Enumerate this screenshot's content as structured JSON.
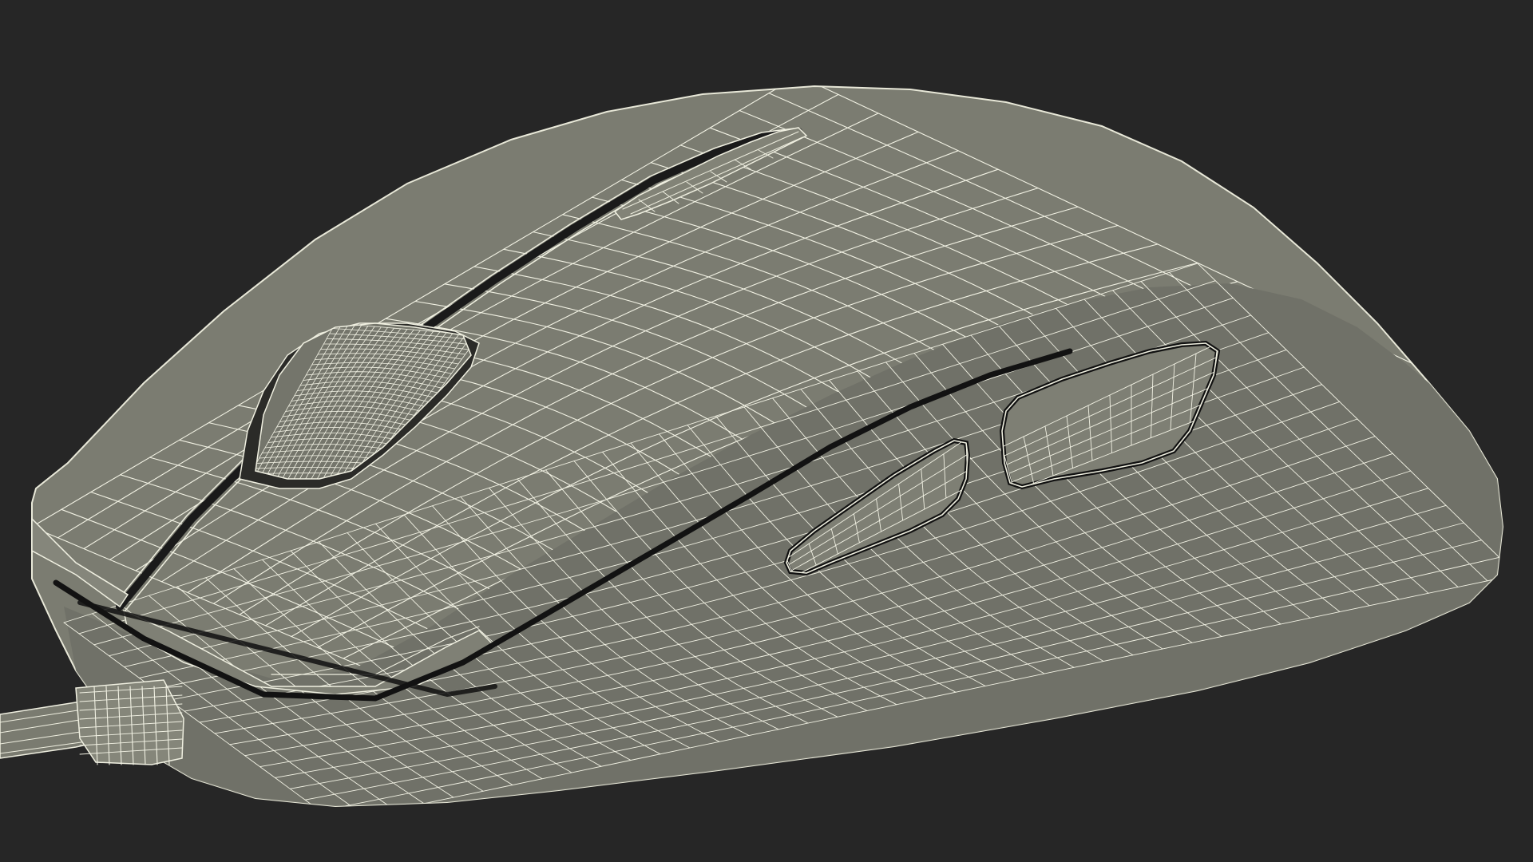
{
  "scene": {
    "subject": "computer-mouse-wireframe",
    "colors": {
      "background": "#262626",
      "surface": "#7c7d72",
      "surface_shadow": "#5f6058",
      "wire": "#f2f2e4",
      "outline": "#111111"
    },
    "parts": [
      "mouse-body",
      "left-button",
      "right-button",
      "scroll-wheel",
      "dpi-button",
      "side-button-front",
      "side-button-back",
      "cable",
      "cable-strain-relief"
    ]
  }
}
